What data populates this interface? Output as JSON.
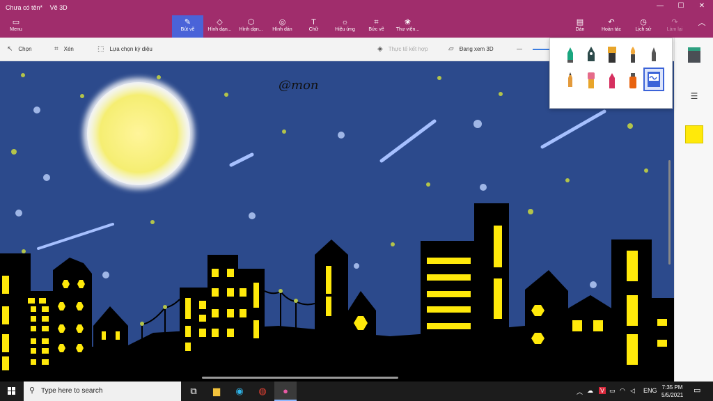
{
  "window": {
    "doc_title": "Chưa có tên*",
    "app_name": "Vẽ 3D",
    "minimize": "—",
    "maximize": "☐",
    "close": "✕"
  },
  "ribbon": {
    "menu": "Menu",
    "tools": [
      {
        "label": "Bút vẽ",
        "icon": "brush-icon"
      },
      {
        "label": "Hình dạn...",
        "icon": "shapes-2d-icon"
      },
      {
        "label": "Hình dạn...",
        "icon": "shapes-3d-icon"
      },
      {
        "label": "Hình dán",
        "icon": "sticker-icon"
      },
      {
        "label": "Chữ",
        "icon": "text-icon"
      },
      {
        "label": "Hiệu ứng",
        "icon": "effects-icon"
      },
      {
        "label": "Bức vẽ",
        "icon": "canvas-icon"
      },
      {
        "label": "Thư viện...",
        "icon": "library-icon"
      }
    ],
    "right": [
      {
        "label": "Dán",
        "icon": "paste-icon"
      },
      {
        "label": "Hoàn tác",
        "icon": "undo-icon"
      },
      {
        "label": "Lịch sử",
        "icon": "history-icon"
      },
      {
        "label": "Làm lại",
        "icon": "redo-icon"
      }
    ]
  },
  "toolbar": {
    "select": "Chọn",
    "crop": "Xén",
    "magic_select": "Lựa chọn kỳ diệu",
    "mixed_reality": "Thực tế kết hợp",
    "view_3d": "Đang xem 3D"
  },
  "canvas": {
    "signature": "@mon"
  },
  "colors": {
    "ribbon": "#a02d6c",
    "active_tool": "#4a63d8",
    "sky": "#2c4a8c",
    "building": "#000000",
    "window_light": "#ffe90a",
    "selected_color": "#ffe90a"
  },
  "brushes": [
    {
      "name": "marker",
      "color": "#1aa67f"
    },
    {
      "name": "calligraphy-pen",
      "color": "#2d4a4a"
    },
    {
      "name": "oil-brush",
      "color": "#e8a52a"
    },
    {
      "name": "watercolor",
      "color": "#f2a93b"
    },
    {
      "name": "pixel-pen",
      "color": "#555"
    },
    {
      "name": "pencil",
      "color": "#e39a3c"
    },
    {
      "name": "eraser",
      "color": "#e56b8a"
    },
    {
      "name": "crayon",
      "color": "#d6305f"
    },
    {
      "name": "spray-can",
      "color": "#e8630f"
    },
    {
      "name": "fill",
      "color": "#3b63d8"
    }
  ],
  "taskbar": {
    "search_placeholder": "Type here to search",
    "language": "ENG",
    "time": "7:35 PM",
    "date": "5/5/2021"
  }
}
